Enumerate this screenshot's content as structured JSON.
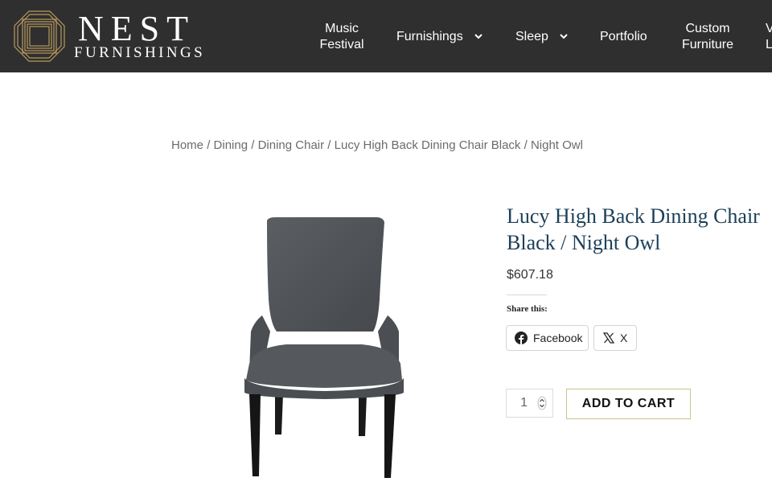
{
  "brand": {
    "name_top": "NEST",
    "name_bottom": "FURNISHINGS"
  },
  "nav": {
    "music_festival": [
      "Music",
      "Festival"
    ],
    "furnishings": "Furnishings",
    "sleep": "Sleep",
    "portfolio": "Portfolio",
    "custom_furniture": [
      "Custom",
      "Furniture"
    ],
    "truncated": [
      "V",
      "L"
    ]
  },
  "breadcrumb": {
    "items": [
      "Home",
      "Dining",
      "Dining Chair",
      "Lucy High Back Dining Chair Black",
      "Night Owl"
    ],
    "separator": "/"
  },
  "product": {
    "title": "Lucy High Back Dining Chair Black / Night Owl",
    "price": "$607.18",
    "share_label": "Share this:",
    "share_buttons": {
      "facebook": "Facebook",
      "x": "X"
    },
    "quantity": "1",
    "add_to_cart": "ADD TO CART"
  },
  "colors": {
    "header_bg": "#2f2f2f",
    "title": "#1c3f58",
    "logo_gold": "#b89a5e",
    "cart_border": "#c9c48a"
  }
}
